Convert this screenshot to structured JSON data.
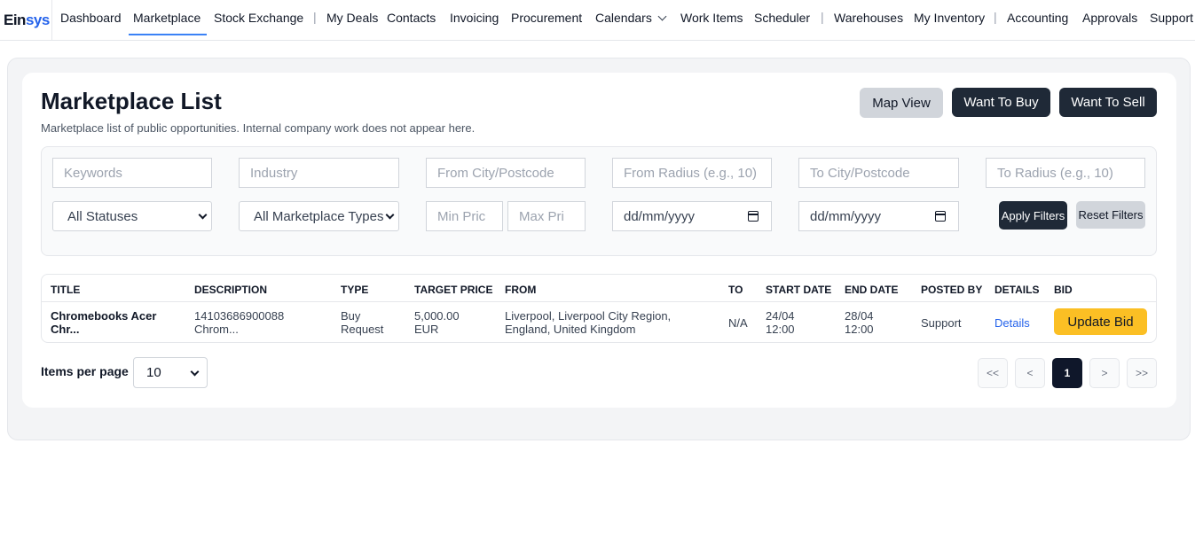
{
  "nav": {
    "logo_a": "Ein",
    "logo_b": "sys",
    "items": [
      "Dashboard",
      "Marketplace",
      "Stock Exchange",
      "My Deals",
      "Contacts",
      "Invoicing",
      "Procurement",
      "Calendars",
      "Work Items",
      "Scheduler",
      "Warehouses",
      "My Inventory",
      "Accounting",
      "Approvals",
      "Support"
    ],
    "separator": "|",
    "active": "Marketplace"
  },
  "header": {
    "title": "Marketplace List",
    "subtitle": "Marketplace list of public opportunities. Internal company work does not appear here.",
    "map_view": "Map View",
    "want_to_buy": "Want To Buy",
    "want_to_sell": "Want To Sell"
  },
  "filters": {
    "keywords": "Keywords",
    "industry": "Industry",
    "from_city": "From City/Postcode",
    "from_radius": "From Radius (e.g., 10)",
    "to_city": "To City/Postcode",
    "to_radius": "To Radius (e.g., 10)",
    "status": "All Statuses",
    "type": "All Marketplace Types",
    "min_price": "Min Pric",
    "max_price": "Max Pri",
    "start_date": "dd/mm/yyyy",
    "end_date": "dd/mm/yyyy",
    "apply": "Apply Filters",
    "reset": "Reset Filters"
  },
  "table": {
    "headers": [
      "TITLE",
      "DESCRIPTION",
      "TYPE",
      "TARGET PRICE",
      "FROM",
      "TO",
      "START DATE",
      "END DATE",
      "POSTED BY",
      "DETAILS",
      "BID"
    ],
    "rows": [
      {
        "title_1": "Chromebooks Acer",
        "title_2": "Chr...",
        "desc_1": "14103686900088",
        "desc_2": "Chrom...",
        "type_1": "Buy",
        "type_2": "Request",
        "price_1": "5,000.00",
        "price_2": "EUR",
        "from_1": "Liverpool, Liverpool City Region,",
        "from_2": "England, United Kingdom",
        "to": "N/A",
        "start_1": "24/04",
        "start_2": "12:00",
        "end_1": "28/04",
        "end_2": "12:00",
        "posted_by": "Support",
        "details": "Details",
        "bid": "Update Bid"
      }
    ]
  },
  "pagination": {
    "items_per_page_label": "Items per page",
    "items_per_page": "10",
    "first": "<<",
    "prev": "<",
    "current": "1",
    "next": ">",
    "last": ">>"
  }
}
